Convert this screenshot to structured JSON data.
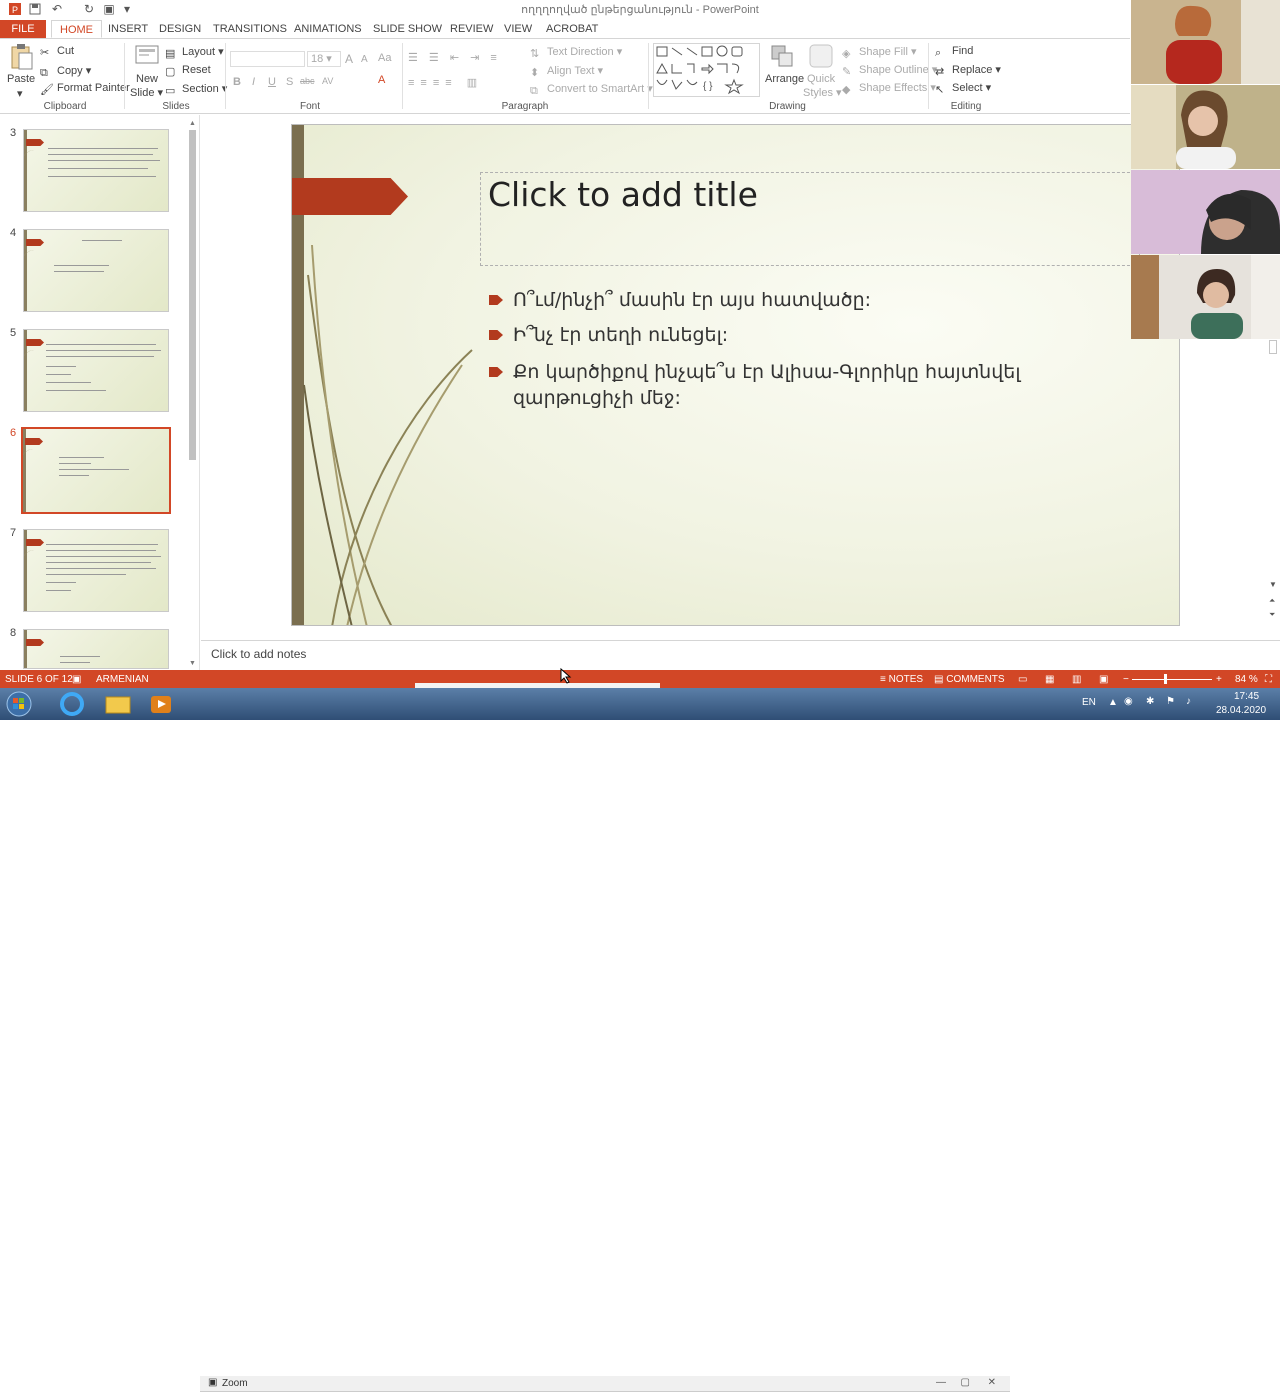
{
  "app": {
    "window_title": "ողղղողված ընթերցանություն - PowerPoint"
  },
  "ribbon": {
    "tabs": [
      "FILE",
      "HOME",
      "INSERT",
      "DESIGN",
      "TRANSITIONS",
      "ANIMATIONS",
      "SLIDE SHOW",
      "REVIEW",
      "VIEW",
      "ACROBAT"
    ],
    "active_tab": "HOME",
    "clipboard": {
      "paste": "Paste",
      "cut": "Cut",
      "copy": "Copy",
      "format_painter": "Format Painter",
      "label": "Clipboard"
    },
    "slides": {
      "new_slide_1": "New",
      "new_slide_2": "Slide",
      "layout": "Layout",
      "reset": "Reset",
      "section": "Section",
      "label": "Slides"
    },
    "font": {
      "size": "18",
      "bold": "B",
      "italic": "I",
      "underline": "U",
      "shadow": "S",
      "strike": "abc",
      "spacing": "AV",
      "case": "Aa",
      "color": "A",
      "grow": "A",
      "shrink": "A",
      "label": "Font"
    },
    "paragraph": {
      "text_direction": "Text Direction",
      "align_text": "Align Text",
      "convert_smartart": "Convert to SmartArt",
      "label": "Paragraph"
    },
    "drawing": {
      "arrange": "Arrange",
      "quick_1": "Quick",
      "quick_2": "Styles",
      "shape_fill": "Shape Fill",
      "shape_outline": "Shape Outline",
      "shape_effects": "Shape Effects",
      "label": "Drawing"
    },
    "editing": {
      "find": "Find",
      "replace": "Replace",
      "select": "Select",
      "label": "Editing"
    }
  },
  "thumbnails": [
    {
      "num": "3",
      "selected": false
    },
    {
      "num": "4",
      "selected": false
    },
    {
      "num": "5",
      "selected": false
    },
    {
      "num": "6",
      "selected": true
    },
    {
      "num": "7",
      "selected": false
    },
    {
      "num": "8",
      "selected": false
    }
  ],
  "slide": {
    "title_placeholder": "Click to add title",
    "bullets": [
      "Ո՞ւմ/ինչի՞ մասին էր այս հատվածը:",
      "Ի՞նչ էր տեղի ունեցել:",
      "Քո կարծիքով ինչպե՞ս էր Ալիսա-Գլորիկը հայտնվել զարթուցիչի մեջ:"
    ],
    "accent_color": "#b23a1e"
  },
  "notes": {
    "placeholder": "Click to add notes"
  },
  "status": {
    "slide_counter": "SLIDE 6 OF 12",
    "language": "ARMENIAN",
    "notes_btn": "NOTES",
    "comments_btn": "COMMENTS",
    "zoom_level": "84 %",
    "accent": "#d24726"
  },
  "taskbar": {
    "zoom_window": "Zoom",
    "lang": "EN",
    "time": "17:45",
    "date": "28.04.2020"
  }
}
